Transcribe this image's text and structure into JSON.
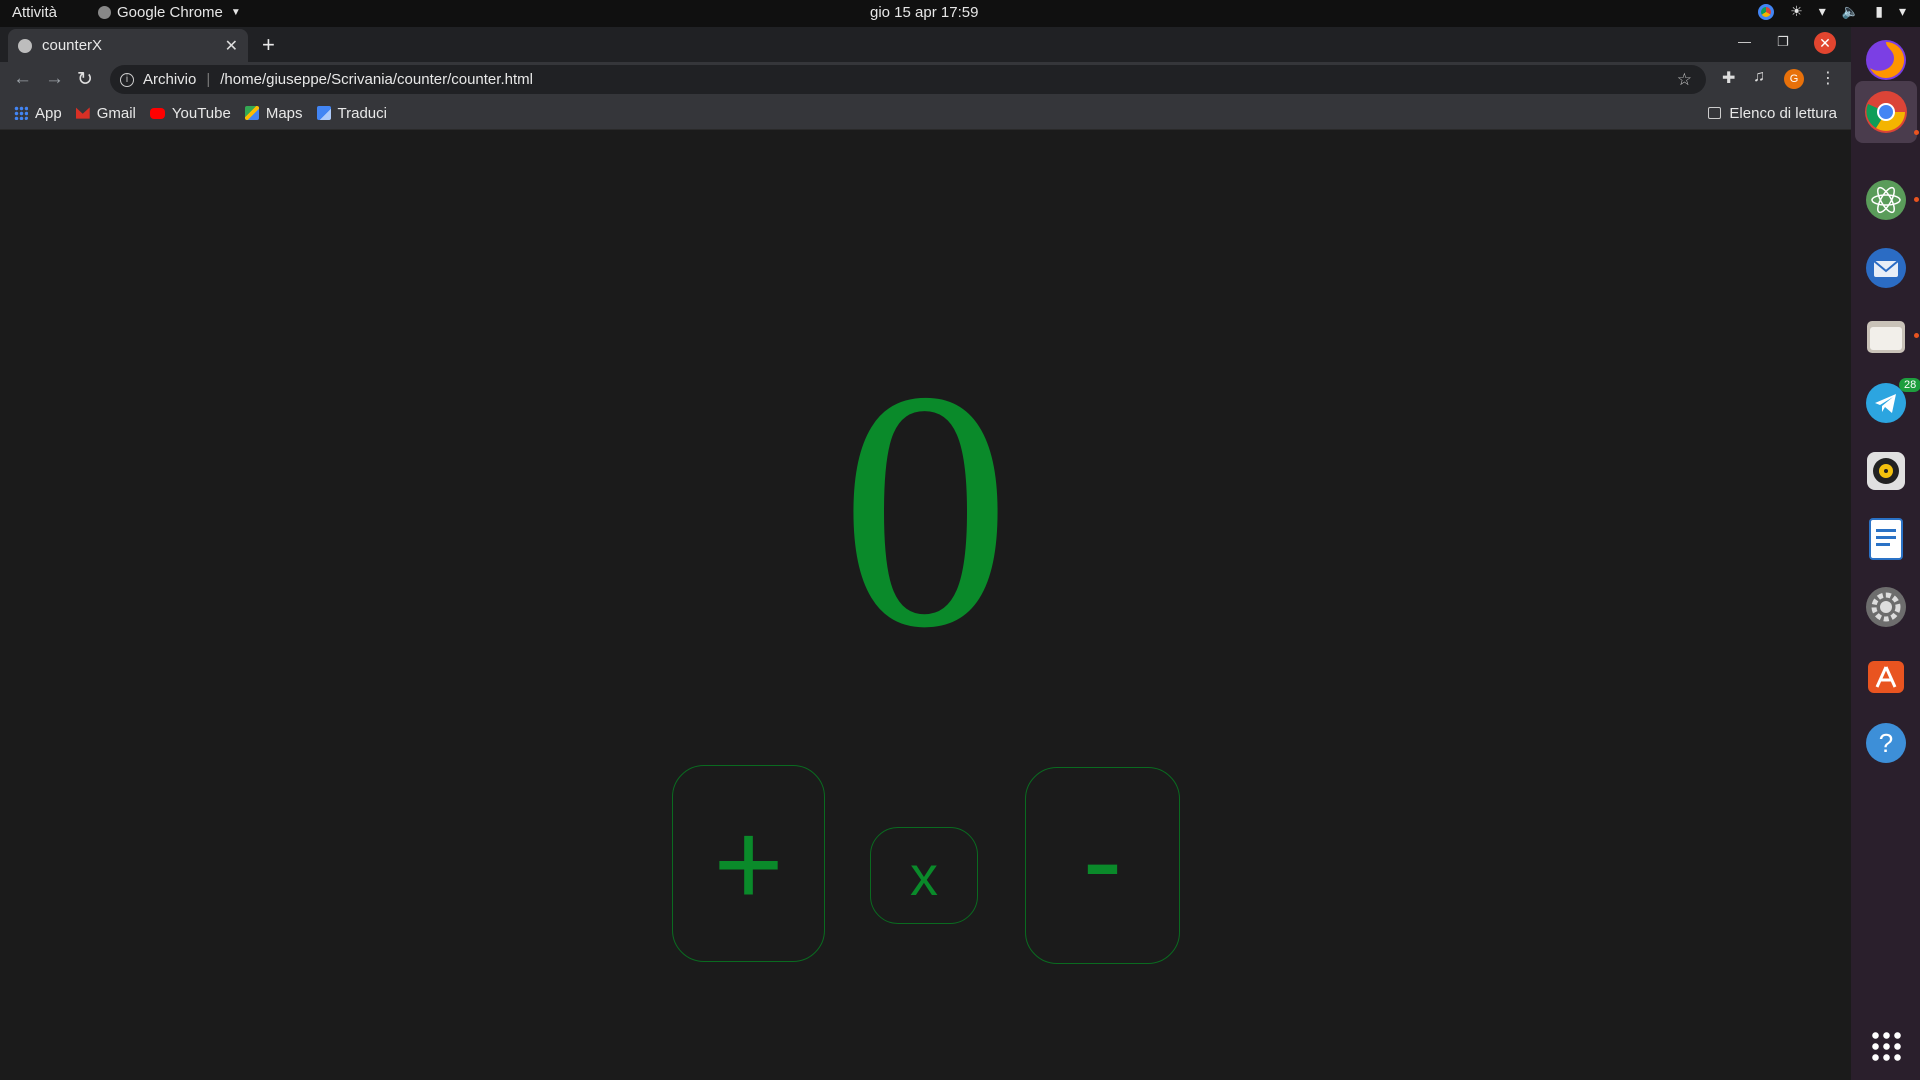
{
  "topbar": {
    "activities": "Attività",
    "app_name": "Google Chrome",
    "clock": "gio 15 apr  17:59"
  },
  "browser": {
    "tab_title": "counterX",
    "address_prefix": "Archivio",
    "url": "/home/giuseppe/Scrivania/counter/counter.html",
    "profile_initial": "G",
    "bookmarks": [
      {
        "label": "App",
        "icon": "apps-icon"
      },
      {
        "label": "Gmail",
        "icon": "gmail-icon"
      },
      {
        "label": "YouTube",
        "icon": "youtube-icon"
      },
      {
        "label": "Maps",
        "icon": "maps-icon"
      },
      {
        "label": "Traduci",
        "icon": "translate-icon"
      }
    ],
    "reading_list": "Elenco di lettura"
  },
  "page": {
    "counter_value": "0",
    "plus_label": "+",
    "reset_label": "x",
    "minus_label": "-",
    "accent_color": "#0a8a2a"
  },
  "dock": {
    "telegram_badge": "28",
    "apps": [
      "firefox-icon",
      "chrome-icon",
      "atom-icon",
      "thunderbird-icon",
      "files-icon",
      "telegram-icon",
      "rhythmbox-icon",
      "writer-icon",
      "settings-icon",
      "software-icon",
      "help-icon",
      "show-apps-icon"
    ]
  }
}
